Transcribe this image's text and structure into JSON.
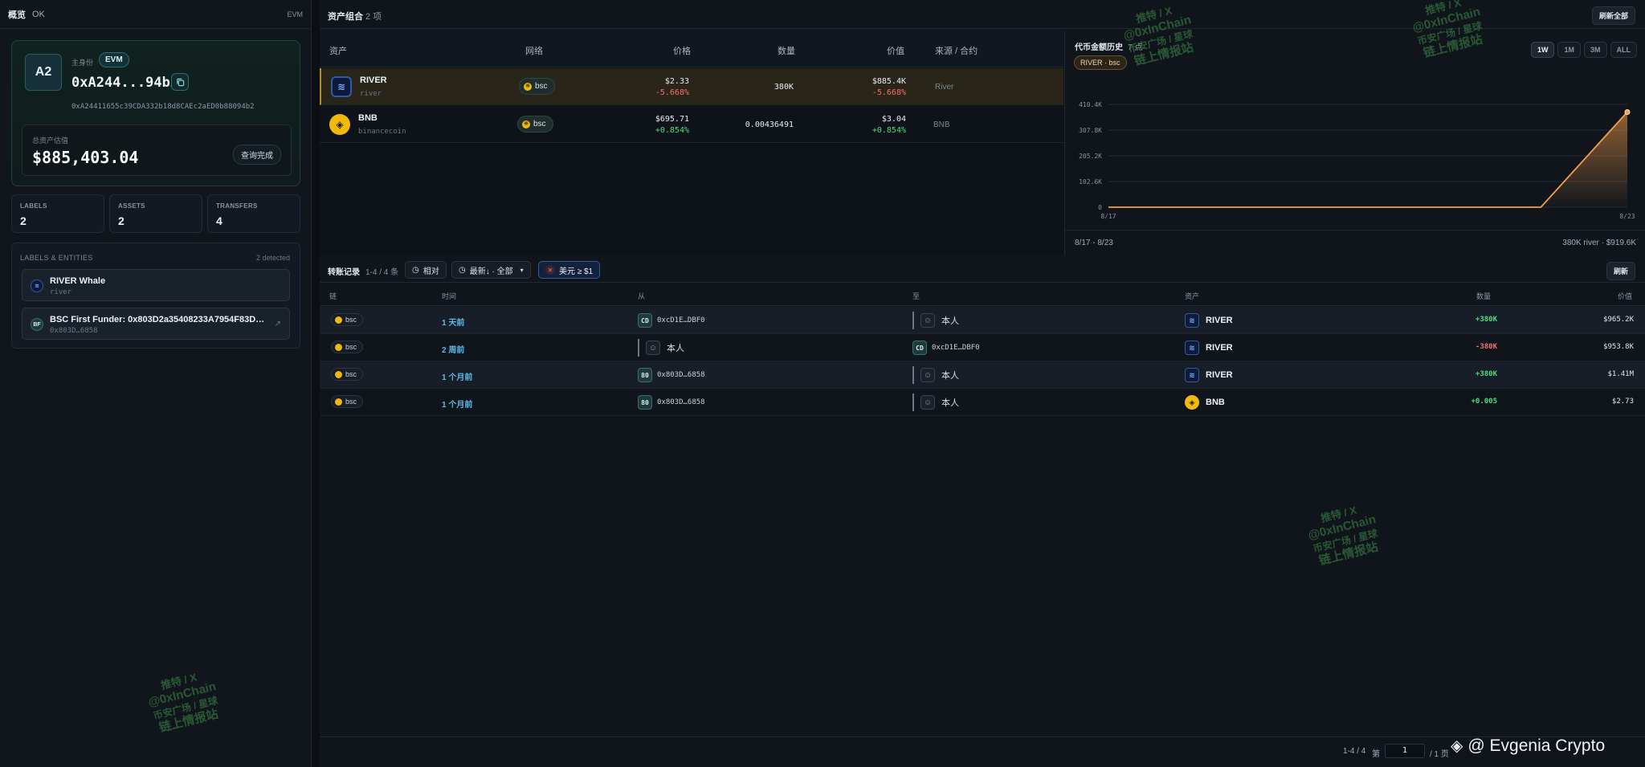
{
  "left": {
    "header_title": "概览",
    "header_status": "OK",
    "header_chain": "EVM",
    "profile": {
      "avatar_text": "A2",
      "primary_label": "主身份",
      "chain_badge": "EVM",
      "short_address": "0xA244...94b2",
      "full_address": "0xA24411655c39CDA332b18d8CAEc2aED0b88094b2",
      "value_label": "总资产估值",
      "value": "$885,403.04",
      "query_done": "查询完成"
    },
    "stats": [
      {
        "label": "LABELS",
        "value": "2"
      },
      {
        "label": "ASSETS",
        "value": "2"
      },
      {
        "label": "TRANSFERS",
        "value": "4"
      }
    ],
    "entities": {
      "header": "LABELS & ENTITIES",
      "count": "2 detected",
      "items": [
        {
          "icon": "river-icon",
          "name": "RIVER Whale",
          "sub": "river"
        },
        {
          "icon": "BF",
          "name": "BSC First Funder: 0x803D2a35408233A7954F83D3...",
          "sub": "0x803D…6858"
        }
      ]
    }
  },
  "main": {
    "header_title": "资产组合",
    "header_count": "2 项",
    "refresh_all": "刷新全部",
    "assets_table": {
      "columns": [
        "资产",
        "网络",
        "价格",
        "数量",
        "价值",
        "来源 / 合约"
      ],
      "rows": [
        {
          "name": "RIVER",
          "sub": "river",
          "network": "bsc",
          "price": "$2.33",
          "price_change": "-5.668%",
          "quantity": "380K",
          "value": "$885.4K",
          "value_change": "-5.668%",
          "source": "River"
        },
        {
          "name": "BNB",
          "sub": "binancecoin",
          "network": "bsc",
          "price": "$695.71",
          "price_change": "+0.854%",
          "quantity": "0.00436491",
          "value": "$3.04",
          "value_change": "+0.854%",
          "source": "BNB"
        }
      ]
    },
    "chart_panel": {
      "title": "代币金额历史",
      "subtitle": "7 点",
      "tag": "RIVER · bsc",
      "ranges": [
        "1W",
        "1M",
        "3M",
        "ALL"
      ],
      "active_range": "1W",
      "footer_left": "8/17 - 8/23",
      "footer_right": "380K river · $919.6K"
    },
    "transfers": {
      "title": "转账记录",
      "count": "1-4 / 4 条",
      "filter_relative": "相对",
      "filter_sort": "最新↓ · 全部",
      "filter_usd": "美元 ≥ $1",
      "refresh": "刷新",
      "columns": [
        "链",
        "时间",
        "从",
        "至",
        "资产",
        "数量",
        "价值"
      ],
      "rows": [
        {
          "chain": "bsc",
          "time": "1 天前",
          "from": {
            "type": "addr",
            "tag": "CD",
            "text": "0xcD1E…DBF0"
          },
          "to": {
            "type": "self",
            "text": "本人"
          },
          "asset": "RIVER",
          "asset_icon": "river",
          "amount": "+380K",
          "value": "$965.2K"
        },
        {
          "chain": "bsc",
          "time": "2 周前",
          "from": {
            "type": "self",
            "text": "本人"
          },
          "to": {
            "type": "addr",
            "tag": "CD",
            "text": "0xcD1E…DBF0"
          },
          "asset": "RIVER",
          "asset_icon": "river",
          "amount": "-380K",
          "value": "$953.8K"
        },
        {
          "chain": "bsc",
          "time": "1 个月前",
          "from": {
            "type": "addr",
            "tag": "80",
            "text": "0x803D…6858"
          },
          "to": {
            "type": "self",
            "text": "本人"
          },
          "asset": "RIVER",
          "asset_icon": "river",
          "amount": "+380K",
          "value": "$1.41M"
        },
        {
          "chain": "bsc",
          "time": "1 个月前",
          "from": {
            "type": "addr",
            "tag": "80",
            "text": "0x803D…6858"
          },
          "to": {
            "type": "self",
            "text": "本人"
          },
          "asset": "BNB",
          "asset_icon": "bnb",
          "amount": "+0.005",
          "value": "$2.73"
        }
      ]
    },
    "pager": {
      "info": "1-4 / 4",
      "page_prefix": "第",
      "page": "1",
      "total": "/ 1 页"
    }
  },
  "chart_data": {
    "type": "area",
    "title": "",
    "x": [
      "8/17",
      "8/18",
      "8/19",
      "8/20",
      "8/21",
      "8/22",
      "8/23"
    ],
    "series": [
      {
        "values": [
          0,
          0,
          0,
          0,
          0,
          0,
          380000
        ]
      }
    ],
    "y_ticks": [
      "0",
      "102.6K",
      "205.2K",
      "307.8K",
      "410.4K"
    ],
    "x_tick_labels": [
      "8/17",
      "8/23"
    ],
    "ylim": [
      0,
      410400
    ],
    "grid": true,
    "line_color": "#f59e4b"
  },
  "watermark": {
    "line1": "推特 / X",
    "line2": "@0xInChain",
    "line3": "币安广场 / 星球",
    "line4": "链上情报站"
  },
  "credit": "@ Evgenia Crypto"
}
